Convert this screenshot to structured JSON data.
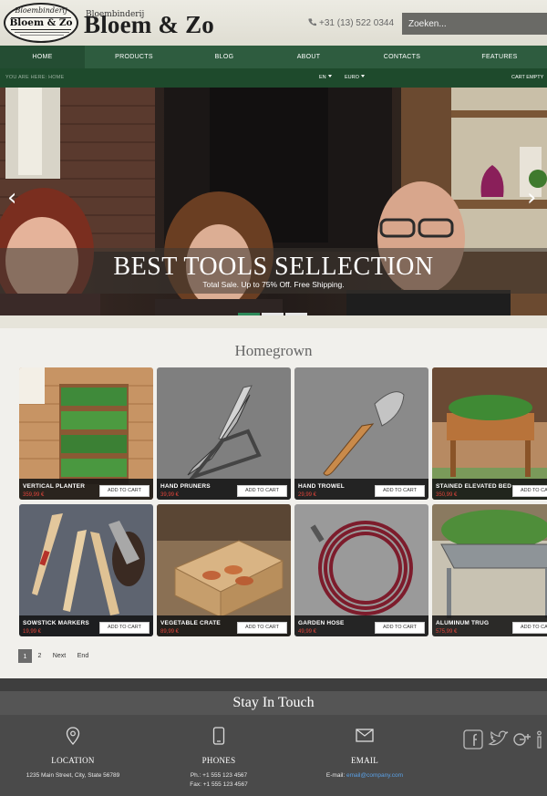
{
  "header": {
    "logo": {
      "line1": "Bloembinderij",
      "line2": "Bloem & Zo"
    },
    "brand_small": "Bloembinderij",
    "brand_big": "Bloem & Zo",
    "phone": "+31 (13) 522 0344",
    "search_placeholder": "Zoeken..."
  },
  "nav": {
    "items": [
      {
        "label": "HOME",
        "active": true
      },
      {
        "label": "PRODUCTS"
      },
      {
        "label": "BLOG"
      },
      {
        "label": "ABOUT"
      },
      {
        "label": "CONTACTS"
      },
      {
        "label": "FEATURES"
      }
    ]
  },
  "subbar": {
    "breadcrumb": "YOU ARE HERE: HOME",
    "language": "EN",
    "currency": "EURO",
    "cart": "CART EMPTY"
  },
  "hero": {
    "title": "BEST TOOLS SELLECTION",
    "subtitle": "Total Sale. Up to 75% Off. Free Shipping.",
    "prev": "‹",
    "next": "›",
    "slides": 3,
    "active_slide": 1
  },
  "section": {
    "title": "Homegrown"
  },
  "products": [
    {
      "name": "VERTICAL PLANTER",
      "price": "359,99 €",
      "button": "ADD TO CART"
    },
    {
      "name": "HAND PRUNERS",
      "price": "39,99 €",
      "button": "ADD TO CART"
    },
    {
      "name": "HAND TROWEL",
      "price": "29,99 €",
      "button": "ADD TO CART"
    },
    {
      "name": "STAINED ELEVATED BED",
      "price": "350,99 €",
      "button": "ADD TO CART"
    },
    {
      "name": "SOWSTICK MARKERS",
      "price": "19,99 €",
      "button": "ADD TO CART"
    },
    {
      "name": "VEGETABLE CRATE",
      "price": "89,99 €",
      "button": "ADD TO CART"
    },
    {
      "name": "GARDEN HOSE",
      "price": "49,99 €",
      "button": "ADD TO CART"
    },
    {
      "name": "ALUMINUM TRUG",
      "price": "575,99 €",
      "button": "ADD TO CART"
    }
  ],
  "pagination": {
    "page1": "1",
    "page2": "2",
    "next": "Next",
    "end": "End"
  },
  "footer": {
    "title": "Stay In Touch",
    "location_label": "LOCATION",
    "location_text": "1235 Main Street, City, State 56789",
    "phones_label": "PHONES",
    "phone1": "Ph.: +1 555 123 4567",
    "phone2": "Fax: +1 555 123 4567",
    "email_label": "EMAIL",
    "email_prefix": "E-mail:",
    "email_value": "email@company.com"
  },
  "colors": {
    "nav": "#2e5c3f",
    "subbar": "#1e4a2c",
    "price": "#e0443a",
    "footer": "#4a4a4a",
    "slider_active": "#2e8a5a"
  }
}
